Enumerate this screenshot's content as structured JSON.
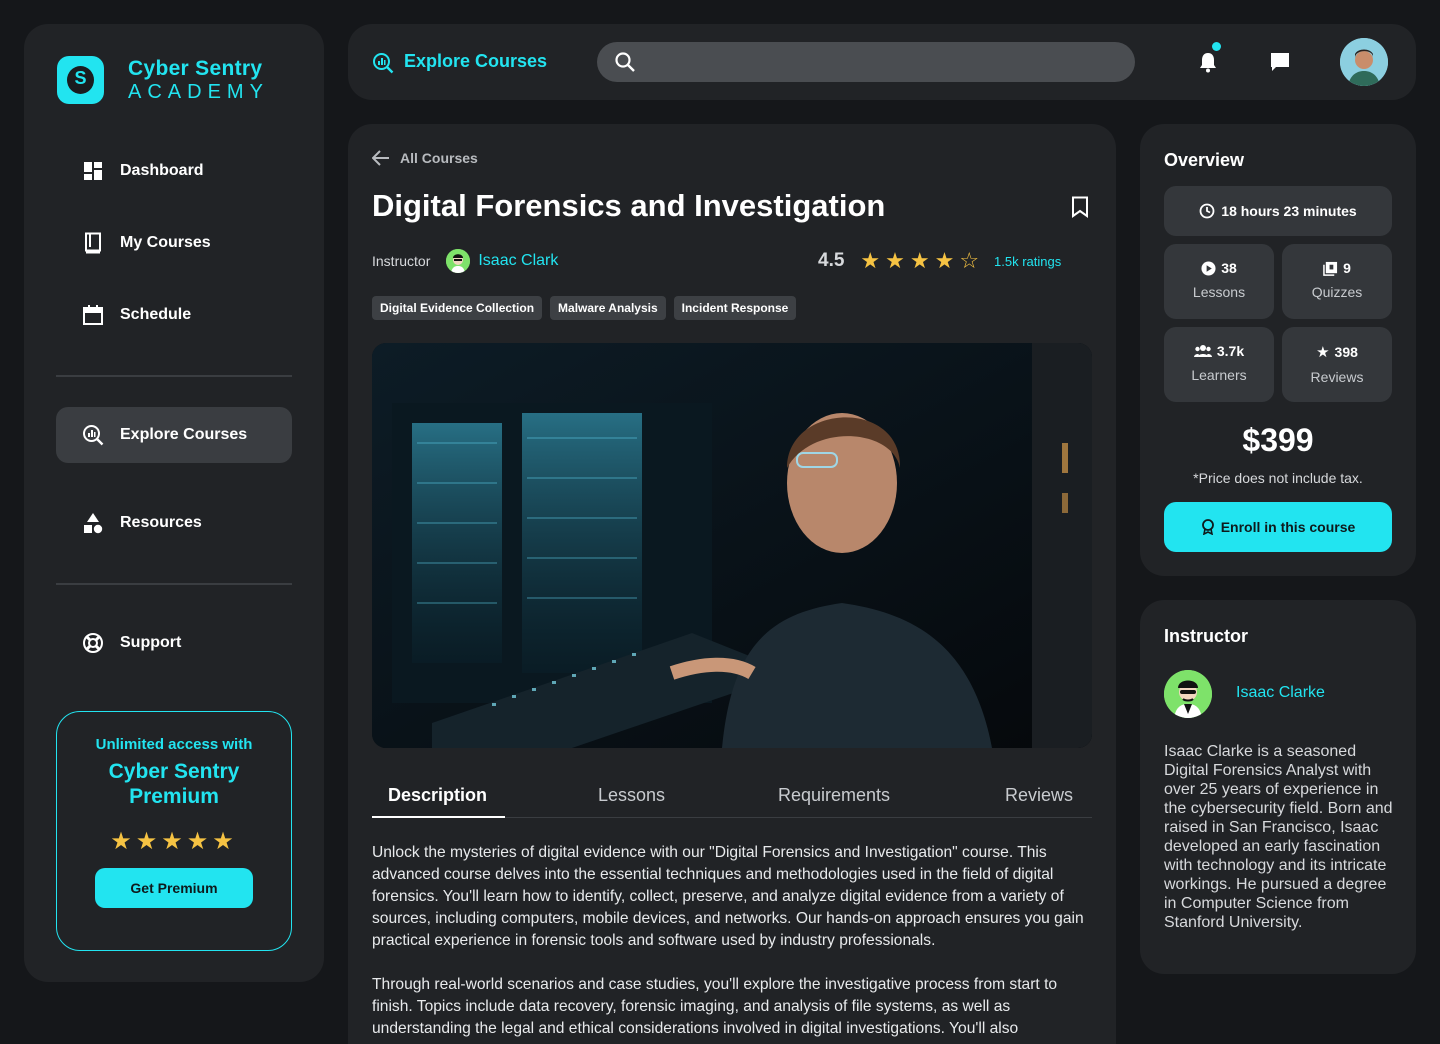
{
  "brand": {
    "name": "Cyber Sentry",
    "tagline": "ACADEMY"
  },
  "sidebar": {
    "items": [
      {
        "label": "Dashboard",
        "icon": "dashboard-icon"
      },
      {
        "label": "My Courses",
        "icon": "book-icon"
      },
      {
        "label": "Schedule",
        "icon": "calendar-icon"
      },
      {
        "label": "Explore Courses",
        "icon": "explore-icon",
        "active": true
      },
      {
        "label": "Resources",
        "icon": "shapes-icon"
      },
      {
        "label": "Support",
        "icon": "lifebuoy-icon"
      }
    ],
    "premium": {
      "line1": "Unlimited access with",
      "line2": "Cyber Sentry Premium",
      "stars": "★★★★★",
      "button": "Get Premium"
    }
  },
  "topbar": {
    "title": "Explore Courses",
    "search_placeholder": "",
    "notification_icon": "bell-icon",
    "chat_icon": "chat-icon"
  },
  "course": {
    "back_label": "All Courses",
    "title": "Digital Forensics and Investigation",
    "instructor_label": "Instructor",
    "instructor_name": "Isaac Clark",
    "rating": "4.5",
    "rating_value": 4.5,
    "ratings_count": "1.5k ratings",
    "tags": [
      "Digital Evidence Collection",
      "Malware Analysis",
      "Incident Response"
    ],
    "tabs": [
      "Description",
      "Lessons",
      "Requirements",
      "Reviews"
    ],
    "active_tab": "Description",
    "description": [
      "Unlock the mysteries of digital evidence with our \"Digital Forensics and Investigation\" course. This advanced course delves into the essential techniques and methodologies used in the field of digital forensics. You'll learn how to identify, collect, preserve, and analyze digital evidence from a variety of sources, including computers, mobile devices, and networks. Our hands-on approach ensures you gain practical experience in forensic tools and software used by industry professionals.",
      "Through real-world scenarios and case studies, you'll explore the investigative process from start to finish. Topics include data recovery, forensic imaging, and analysis of file systems, as well as understanding the legal and ethical considerations involved in digital investigations. You'll also"
    ]
  },
  "overview": {
    "title": "Overview",
    "duration": "18 hours 23 minutes",
    "stats": [
      {
        "value": "38",
        "label": "Lessons",
        "icon": "play-icon"
      },
      {
        "value": "9",
        "label": "Quizzes",
        "icon": "quiz-icon"
      },
      {
        "value": "3.7k",
        "label": "Learners",
        "icon": "people-icon"
      },
      {
        "value": "398",
        "label": "Reviews",
        "icon": "star-icon"
      }
    ],
    "price": "$399",
    "price_note": "*Price does not include tax.",
    "enroll": "Enroll in this course"
  },
  "instructor_card": {
    "title": "Instructor",
    "name": "Isaac Clarke",
    "bio": "Isaac Clarke is a seasoned Digital Forensics Analyst with over 25 years of experience in the cybersecurity field. Born and raised in San Francisco, Isaac developed an early fascination with technology and its intricate workings. He pursued a degree in Computer Science from Stanford University."
  },
  "colors": {
    "accent": "#22e4f0",
    "star": "#f6c343",
    "panel": "#212326",
    "background": "#15171a"
  }
}
